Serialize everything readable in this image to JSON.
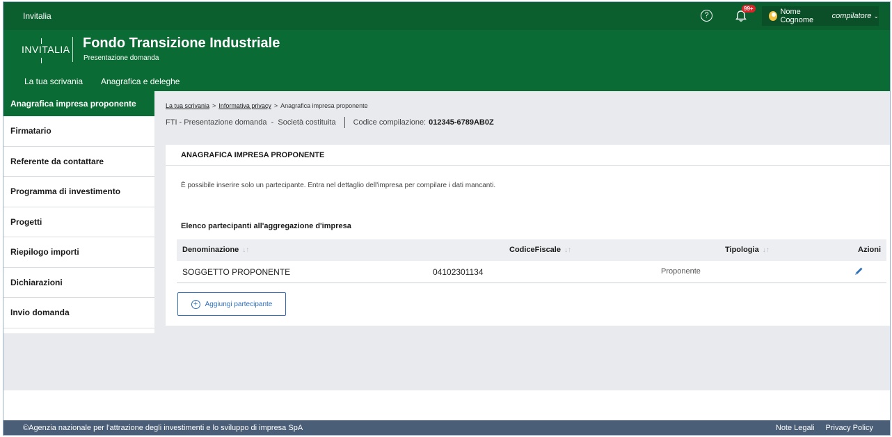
{
  "topbar": {
    "brand": "Invitalia",
    "help_glyph": "?",
    "notifications_badge": "99+",
    "user_name": "Nome Cognome",
    "user_role": "compilatore"
  },
  "header": {
    "logo": "INVITALIA",
    "title": "Fondo Transizione Industriale",
    "subtitle": "Presentazione domanda",
    "nav": [
      "La tua scrivania",
      "Anagrafica e deleghe"
    ]
  },
  "sidebar": {
    "items": [
      "Anagrafica impresa proponente",
      "Firmatario",
      "Referente da contattare",
      "Programma di investimento",
      "Progetti",
      "Riepilogo importi",
      "Dichiarazioni",
      "Invio domanda"
    ]
  },
  "breadcrumb": {
    "items": [
      "La tua scrivania",
      "Informativa privacy",
      "Anagrafica impresa proponente"
    ],
    "separator": ">"
  },
  "meta": {
    "left": "FTI - Presentazione domanda  -  Società costituita",
    "code_label": "Codice compilazione:",
    "code_value": "012345-6789AB0Z"
  },
  "card": {
    "title": "ANAGRAFICA IMPRESA PROPONENTE",
    "info": "È possibile inserire solo un partecipante. Entra nel dettaglio dell'impresa per compilare i dati mancanti.",
    "list_title": "Elenco partecipanti all'aggregazione d'impresa",
    "columns": [
      "Denominazione",
      "CodiceFiscale",
      "Tipologia",
      "Azioni"
    ],
    "sort_glyph": "↓↑",
    "rows": [
      {
        "denominazione": "SOGGETTO PROPONENTE",
        "codice_fiscale": "04102301134",
        "tipologia": "Proponente"
      }
    ],
    "add_button": "Aggiungi partecipante"
  },
  "footer": {
    "copyright": "©Agenzia nazionale per l'attrazione degli investimenti e lo sviluppo di impresa SpA",
    "links": [
      "Note Legali",
      "Privacy Policy"
    ]
  },
  "colors": {
    "topbar": "#0b5e2e",
    "header": "#0b6b34",
    "accent_blue": "#2f6fb7",
    "footer": "#4a5e77",
    "badge": "#d9262b"
  }
}
